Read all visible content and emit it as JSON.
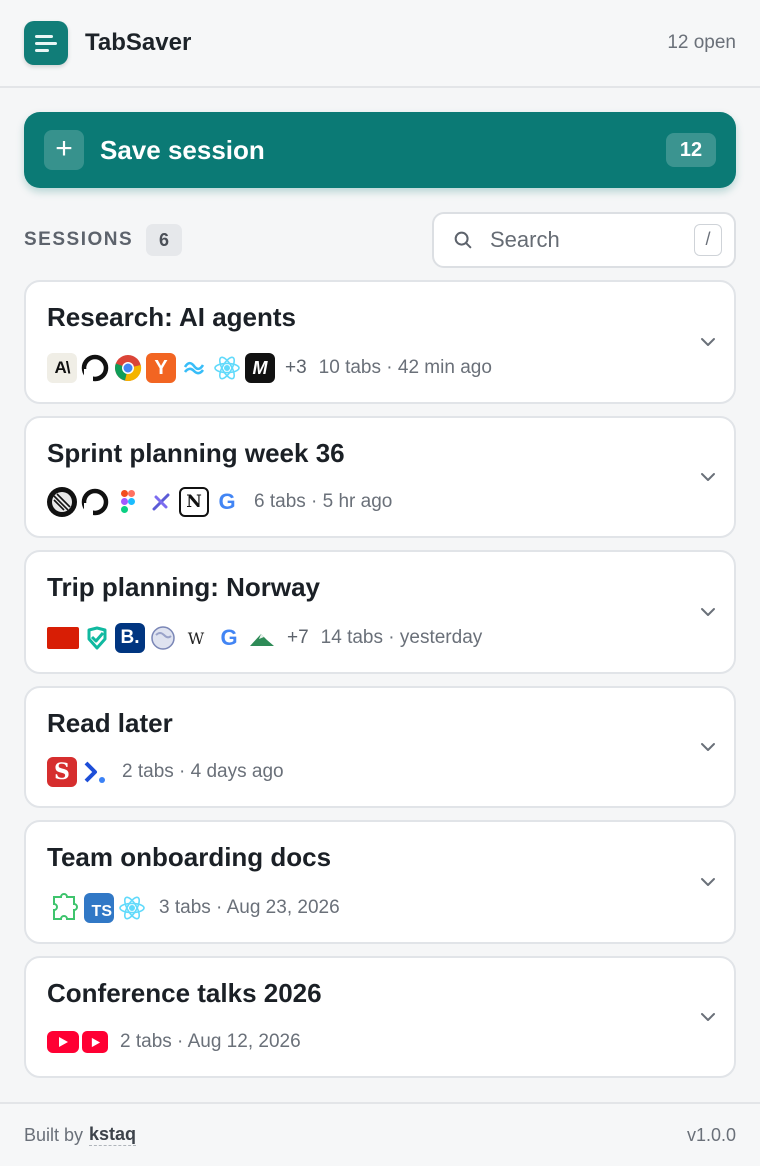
{
  "app": {
    "title": "TabSaver",
    "open_count": "12 open"
  },
  "save": {
    "label": "Save session",
    "badge": "12",
    "plus": "+"
  },
  "sessions": {
    "label": "SESSIONS",
    "count": "6"
  },
  "search": {
    "placeholder": "Search",
    "shortcut": "/"
  },
  "cards": [
    {
      "title": "Research: AI agents",
      "more": "+3",
      "meta": "10 tabs · 42 min ago",
      "favicons": [
        "anthropic-favicon",
        "github-favicon",
        "chrome-favicon",
        "ycombinator-favicon",
        "tailwind-favicon",
        "react-favicon",
        "medium-favicon"
      ]
    },
    {
      "title": "Sprint planning week 36",
      "more": "",
      "meta": "6 tabs · 5 hr ago",
      "favicons": [
        "linear-favicon",
        "github-favicon",
        "figma-favicon",
        "tool-favicon",
        "notion-favicon",
        "google-favicon"
      ]
    },
    {
      "title": "Trip planning: Norway",
      "more": "+7",
      "meta": "14 tabs · yesterday",
      "favicons": [
        "norwegian-favicon",
        "check-favicon",
        "booking-favicon",
        "globe-favicon",
        "wikipedia-favicon",
        "google-favicon",
        "mountain-favicon"
      ]
    },
    {
      "title": "Read later",
      "more": "",
      "meta": "2 tabs · 4 days ago",
      "favicons": [
        "substack-favicon",
        "arrow-favicon"
      ]
    },
    {
      "title": "Team onboarding docs",
      "more": "",
      "meta": "3 tabs · Aug 23, 2026",
      "favicons": [
        "puzzle-favicon",
        "typescript-favicon",
        "react-favicon"
      ]
    },
    {
      "title": "Conference talks 2026",
      "more": "",
      "meta": "2 tabs · Aug 12, 2026",
      "favicons": [
        "youtube-favicon",
        "youtube-favicon"
      ]
    }
  ],
  "footer": {
    "built_by": "Built by",
    "author": "kstaq",
    "version": "v1.0.0"
  },
  "colors": {
    "accent": "#0b7a75",
    "logo": "#117d78"
  }
}
